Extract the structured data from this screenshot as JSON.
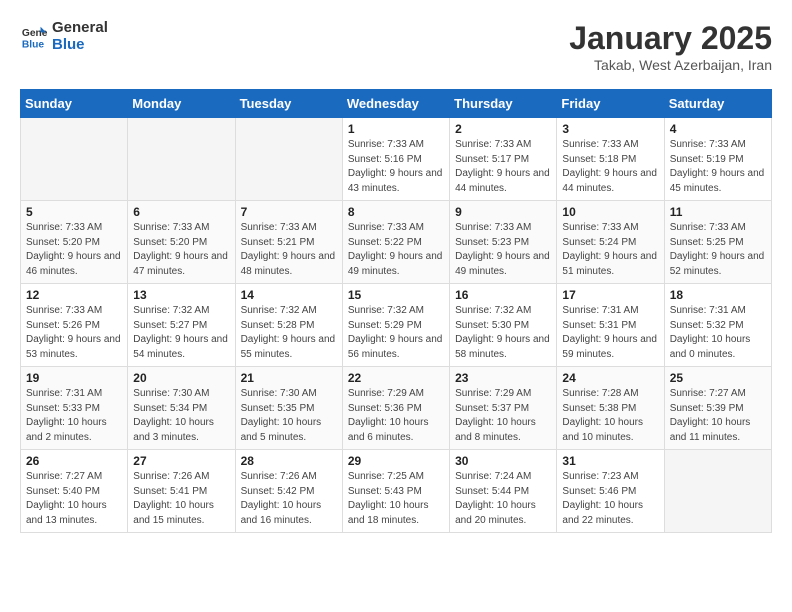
{
  "logo": {
    "line1": "General",
    "line2": "Blue"
  },
  "title": "January 2025",
  "subtitle": "Takab, West Azerbaijan, Iran",
  "headers": [
    "Sunday",
    "Monday",
    "Tuesday",
    "Wednesday",
    "Thursday",
    "Friday",
    "Saturday"
  ],
  "weeks": [
    [
      {
        "num": "",
        "sunrise": "",
        "sunset": "",
        "daylight": "",
        "empty": true
      },
      {
        "num": "",
        "sunrise": "",
        "sunset": "",
        "daylight": "",
        "empty": true
      },
      {
        "num": "",
        "sunrise": "",
        "sunset": "",
        "daylight": "",
        "empty": true
      },
      {
        "num": "1",
        "sunrise": "Sunrise: 7:33 AM",
        "sunset": "Sunset: 5:16 PM",
        "daylight": "Daylight: 9 hours and 43 minutes."
      },
      {
        "num": "2",
        "sunrise": "Sunrise: 7:33 AM",
        "sunset": "Sunset: 5:17 PM",
        "daylight": "Daylight: 9 hours and 44 minutes."
      },
      {
        "num": "3",
        "sunrise": "Sunrise: 7:33 AM",
        "sunset": "Sunset: 5:18 PM",
        "daylight": "Daylight: 9 hours and 44 minutes."
      },
      {
        "num": "4",
        "sunrise": "Sunrise: 7:33 AM",
        "sunset": "Sunset: 5:19 PM",
        "daylight": "Daylight: 9 hours and 45 minutes."
      }
    ],
    [
      {
        "num": "5",
        "sunrise": "Sunrise: 7:33 AM",
        "sunset": "Sunset: 5:20 PM",
        "daylight": "Daylight: 9 hours and 46 minutes."
      },
      {
        "num": "6",
        "sunrise": "Sunrise: 7:33 AM",
        "sunset": "Sunset: 5:20 PM",
        "daylight": "Daylight: 9 hours and 47 minutes."
      },
      {
        "num": "7",
        "sunrise": "Sunrise: 7:33 AM",
        "sunset": "Sunset: 5:21 PM",
        "daylight": "Daylight: 9 hours and 48 minutes."
      },
      {
        "num": "8",
        "sunrise": "Sunrise: 7:33 AM",
        "sunset": "Sunset: 5:22 PM",
        "daylight": "Daylight: 9 hours and 49 minutes."
      },
      {
        "num": "9",
        "sunrise": "Sunrise: 7:33 AM",
        "sunset": "Sunset: 5:23 PM",
        "daylight": "Daylight: 9 hours and 49 minutes."
      },
      {
        "num": "10",
        "sunrise": "Sunrise: 7:33 AM",
        "sunset": "Sunset: 5:24 PM",
        "daylight": "Daylight: 9 hours and 51 minutes."
      },
      {
        "num": "11",
        "sunrise": "Sunrise: 7:33 AM",
        "sunset": "Sunset: 5:25 PM",
        "daylight": "Daylight: 9 hours and 52 minutes."
      }
    ],
    [
      {
        "num": "12",
        "sunrise": "Sunrise: 7:33 AM",
        "sunset": "Sunset: 5:26 PM",
        "daylight": "Daylight: 9 hours and 53 minutes."
      },
      {
        "num": "13",
        "sunrise": "Sunrise: 7:32 AM",
        "sunset": "Sunset: 5:27 PM",
        "daylight": "Daylight: 9 hours and 54 minutes."
      },
      {
        "num": "14",
        "sunrise": "Sunrise: 7:32 AM",
        "sunset": "Sunset: 5:28 PM",
        "daylight": "Daylight: 9 hours and 55 minutes."
      },
      {
        "num": "15",
        "sunrise": "Sunrise: 7:32 AM",
        "sunset": "Sunset: 5:29 PM",
        "daylight": "Daylight: 9 hours and 56 minutes."
      },
      {
        "num": "16",
        "sunrise": "Sunrise: 7:32 AM",
        "sunset": "Sunset: 5:30 PM",
        "daylight": "Daylight: 9 hours and 58 minutes."
      },
      {
        "num": "17",
        "sunrise": "Sunrise: 7:31 AM",
        "sunset": "Sunset: 5:31 PM",
        "daylight": "Daylight: 9 hours and 59 minutes."
      },
      {
        "num": "18",
        "sunrise": "Sunrise: 7:31 AM",
        "sunset": "Sunset: 5:32 PM",
        "daylight": "Daylight: 10 hours and 0 minutes."
      }
    ],
    [
      {
        "num": "19",
        "sunrise": "Sunrise: 7:31 AM",
        "sunset": "Sunset: 5:33 PM",
        "daylight": "Daylight: 10 hours and 2 minutes."
      },
      {
        "num": "20",
        "sunrise": "Sunrise: 7:30 AM",
        "sunset": "Sunset: 5:34 PM",
        "daylight": "Daylight: 10 hours and 3 minutes."
      },
      {
        "num": "21",
        "sunrise": "Sunrise: 7:30 AM",
        "sunset": "Sunset: 5:35 PM",
        "daylight": "Daylight: 10 hours and 5 minutes."
      },
      {
        "num": "22",
        "sunrise": "Sunrise: 7:29 AM",
        "sunset": "Sunset: 5:36 PM",
        "daylight": "Daylight: 10 hours and 6 minutes."
      },
      {
        "num": "23",
        "sunrise": "Sunrise: 7:29 AM",
        "sunset": "Sunset: 5:37 PM",
        "daylight": "Daylight: 10 hours and 8 minutes."
      },
      {
        "num": "24",
        "sunrise": "Sunrise: 7:28 AM",
        "sunset": "Sunset: 5:38 PM",
        "daylight": "Daylight: 10 hours and 10 minutes."
      },
      {
        "num": "25",
        "sunrise": "Sunrise: 7:27 AM",
        "sunset": "Sunset: 5:39 PM",
        "daylight": "Daylight: 10 hours and 11 minutes."
      }
    ],
    [
      {
        "num": "26",
        "sunrise": "Sunrise: 7:27 AM",
        "sunset": "Sunset: 5:40 PM",
        "daylight": "Daylight: 10 hours and 13 minutes."
      },
      {
        "num": "27",
        "sunrise": "Sunrise: 7:26 AM",
        "sunset": "Sunset: 5:41 PM",
        "daylight": "Daylight: 10 hours and 15 minutes."
      },
      {
        "num": "28",
        "sunrise": "Sunrise: 7:26 AM",
        "sunset": "Sunset: 5:42 PM",
        "daylight": "Daylight: 10 hours and 16 minutes."
      },
      {
        "num": "29",
        "sunrise": "Sunrise: 7:25 AM",
        "sunset": "Sunset: 5:43 PM",
        "daylight": "Daylight: 10 hours and 18 minutes."
      },
      {
        "num": "30",
        "sunrise": "Sunrise: 7:24 AM",
        "sunset": "Sunset: 5:44 PM",
        "daylight": "Daylight: 10 hours and 20 minutes."
      },
      {
        "num": "31",
        "sunrise": "Sunrise: 7:23 AM",
        "sunset": "Sunset: 5:46 PM",
        "daylight": "Daylight: 10 hours and 22 minutes."
      },
      {
        "num": "",
        "sunrise": "",
        "sunset": "",
        "daylight": "",
        "empty": true
      }
    ]
  ]
}
